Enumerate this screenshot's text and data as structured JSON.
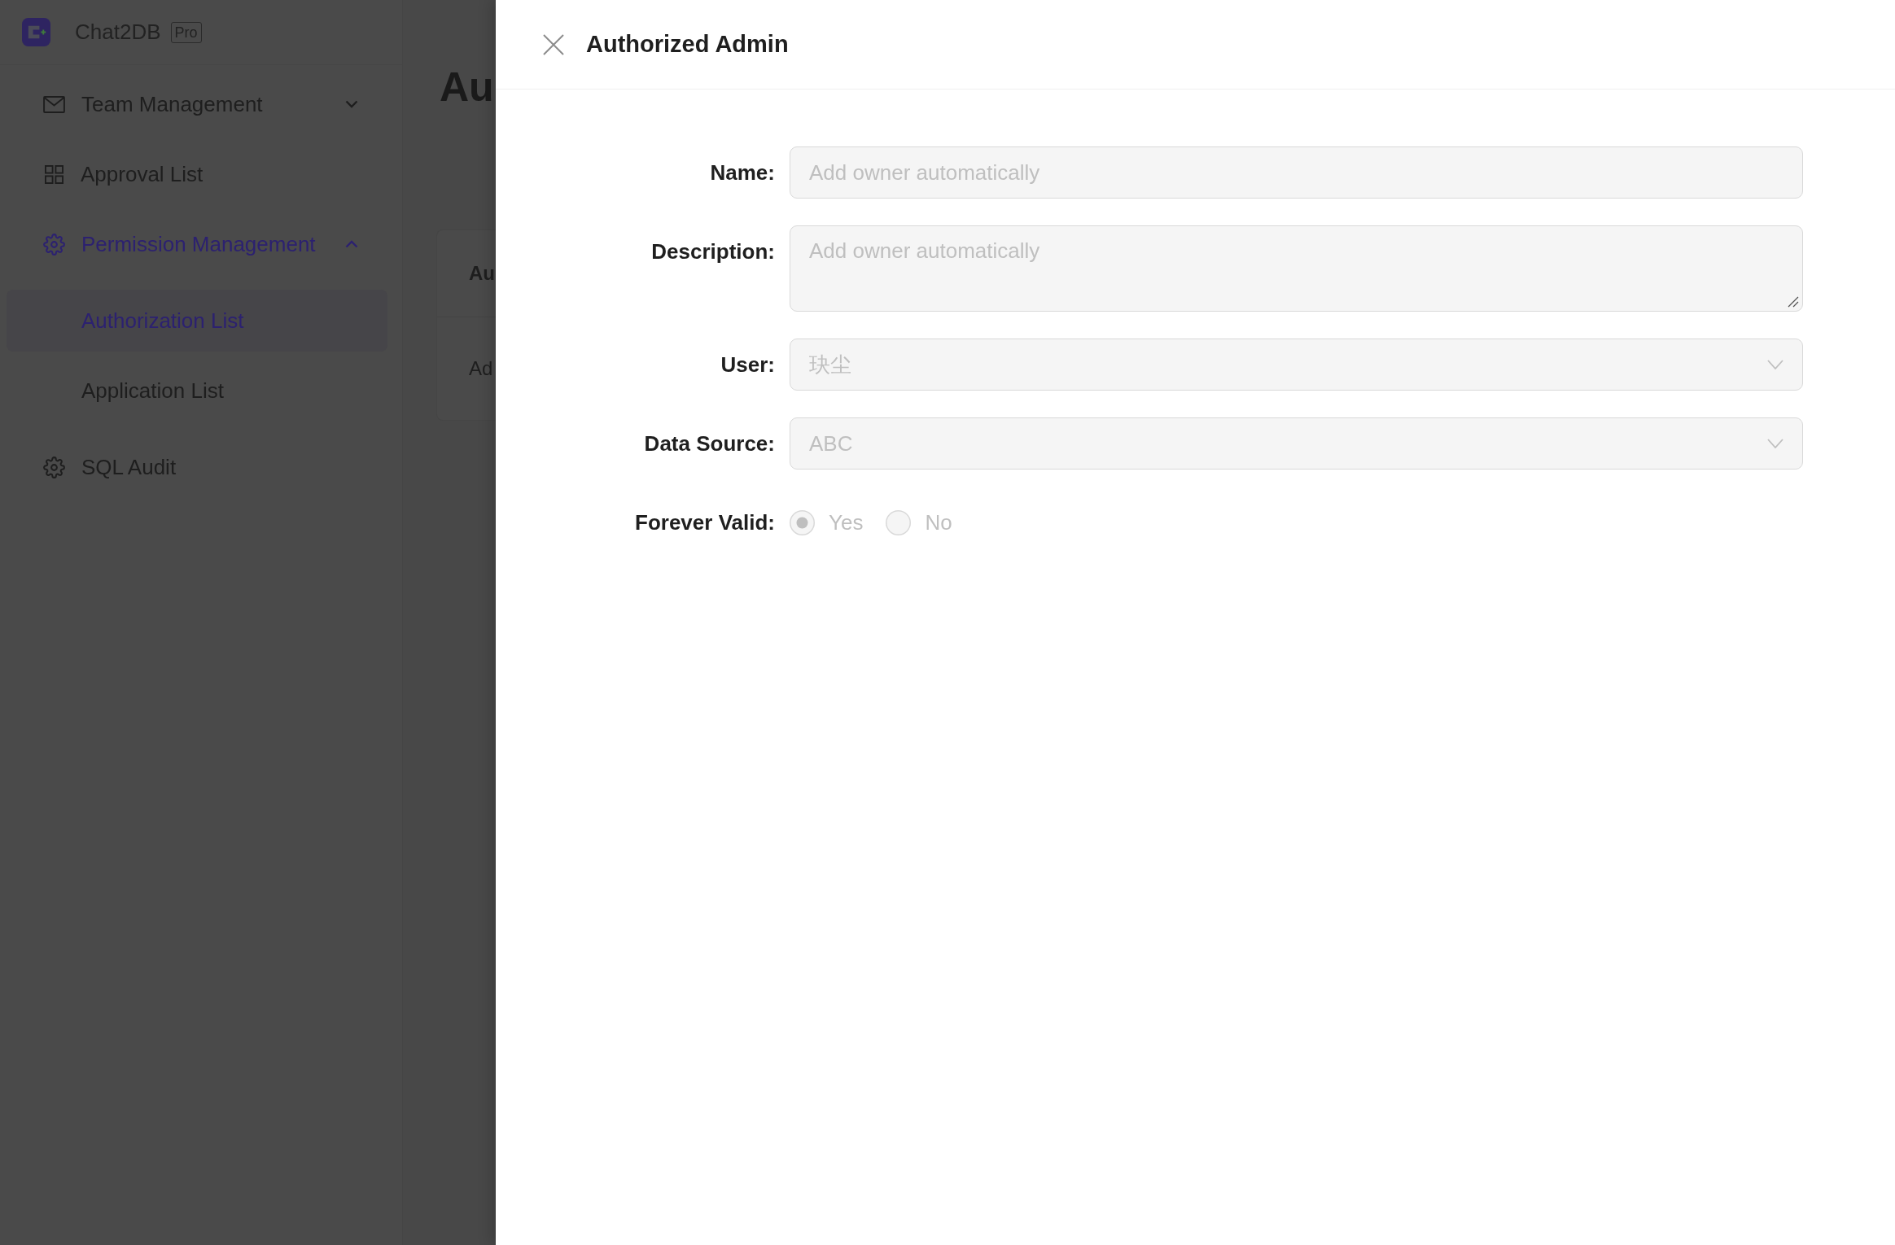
{
  "app": {
    "name": "Chat2DB",
    "badge": "Pro"
  },
  "sidebar": {
    "items": [
      {
        "kind": "group",
        "label": "Team Management",
        "selected": false,
        "expanded": false
      },
      {
        "kind": "link",
        "label": "Approval List",
        "selected": false
      },
      {
        "kind": "group",
        "label": "Permission Management",
        "selected": true,
        "expanded": true,
        "children": [
          {
            "label": "Authorization List",
            "selected": true
          },
          {
            "label": "Application List",
            "selected": false
          }
        ]
      },
      {
        "kind": "link",
        "label": "SQL Audit",
        "selected": false
      }
    ]
  },
  "page": {
    "title": "Au",
    "table": {
      "header": "Au",
      "rows": [
        "Ad"
      ]
    }
  },
  "drawer": {
    "title": "Authorized Admin",
    "fields": [
      {
        "kind": "input",
        "label": "Name:",
        "placeholder": "Add owner automatically",
        "disabled": true
      },
      {
        "kind": "textarea",
        "label": "Description:",
        "placeholder": "Add owner automatically",
        "disabled": true
      },
      {
        "kind": "select",
        "label": "User:",
        "value": "玦尘",
        "disabled": true
      },
      {
        "kind": "select",
        "label": "Data Source:",
        "value": "ABC",
        "disabled": true
      },
      {
        "kind": "radio",
        "label": "Forever Valid:",
        "disabled": true,
        "options": [
          {
            "label": "Yes",
            "selected": true
          },
          {
            "label": "No",
            "selected": false
          }
        ]
      }
    ]
  }
}
